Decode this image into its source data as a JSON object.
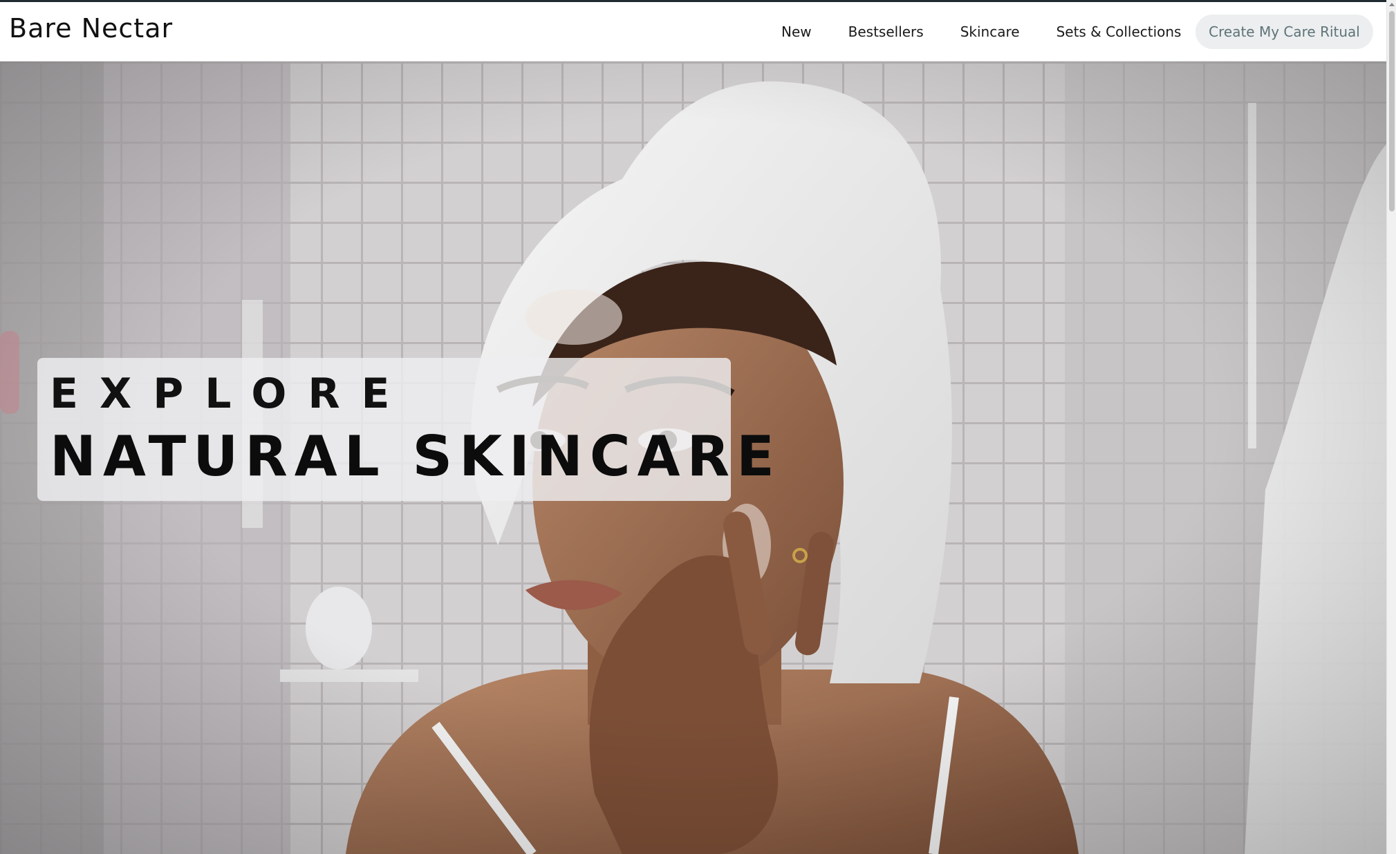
{
  "header": {
    "logo": "Bare Nectar",
    "nav": [
      {
        "label": "New"
      },
      {
        "label": "Bestsellers"
      },
      {
        "label": "Skincare"
      },
      {
        "label": "Sets & Collections"
      }
    ],
    "cta_label": "Create My Care Ritual"
  },
  "hero": {
    "eyebrow": "EXPLORE",
    "title": "NATURAL SKINCARE",
    "image_alt_icon": "hero-photo-woman-applying-skincare"
  },
  "colors": {
    "header_border": "#1f2a30",
    "cta_bg": "#eceeef",
    "cta_text": "#5e7378",
    "hero_card_bg": "#eeeef0"
  }
}
